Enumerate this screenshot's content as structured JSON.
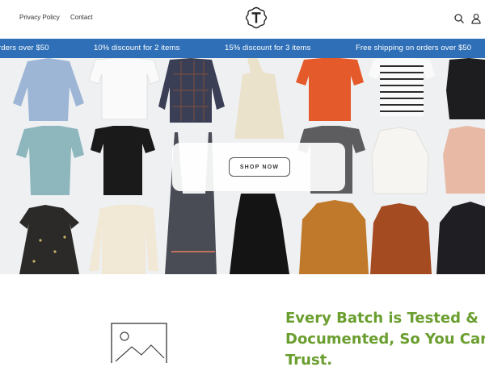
{
  "header": {
    "nav": [
      {
        "label": "Privacy Policy"
      },
      {
        "label": "Contact"
      }
    ],
    "logo_icon": "t-monogram-logo",
    "search_icon": "search-icon",
    "account_icon": "user-icon"
  },
  "announcement": {
    "items": [
      "rders over $50",
      "10% discount for 2 items",
      "15% discount for 3 items",
      "Free shipping on orders over $50"
    ],
    "background": "#2e6fb7"
  },
  "hero": {
    "button_label": "SHOP NOW"
  },
  "feature": {
    "headline_lines": [
      "Every Batch is Tested &",
      "Documented, So You Can",
      "Trust."
    ],
    "headline_color": "#6a9e2e",
    "image_icon": "image-placeholder-icon"
  }
}
